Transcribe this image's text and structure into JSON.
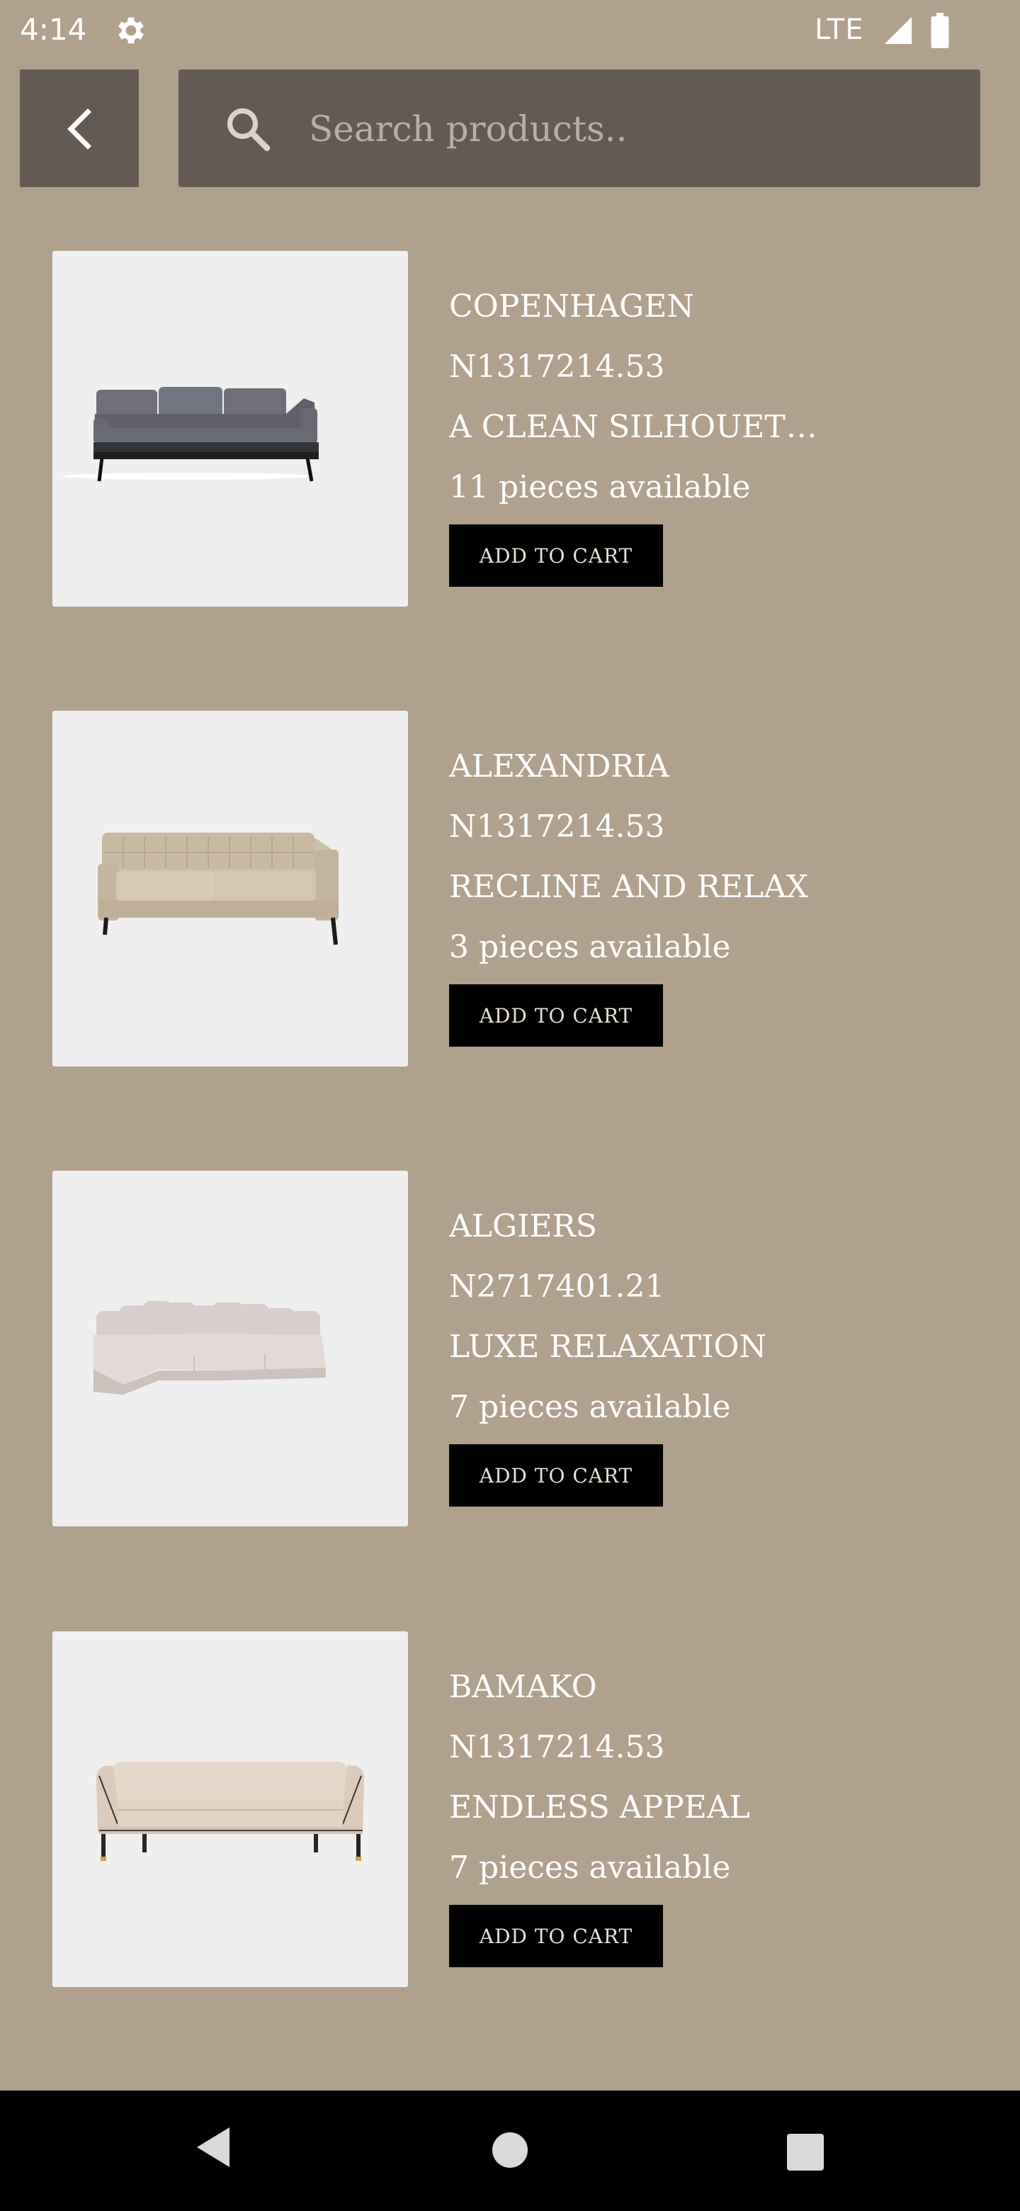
{
  "status_bar": {
    "time": "4:14",
    "network": "LTE",
    "icons": [
      "gear-icon",
      "signal-icon",
      "battery-icon"
    ]
  },
  "header": {
    "back_icon": "chevron-left-icon",
    "search_icon": "search-icon",
    "search_placeholder": "Search products..",
    "search_value": ""
  },
  "products": [
    {
      "name": "COPENHAGEN",
      "price": "N1317214.53",
      "tagline": "A CLEAN SILHOUETT...",
      "availability": "11 pieces available",
      "button_label": "ADD TO CART",
      "image": "grey-sofa"
    },
    {
      "name": "ALEXANDRIA",
      "price": "N1317214.53",
      "tagline": "RECLINE AND RELAX",
      "availability": "3 pieces available",
      "button_label": "ADD TO CART",
      "image": "beige-tufted-sofa"
    },
    {
      "name": "ALGIERS",
      "price": "N2717401.21",
      "tagline": "LUXE RELAXATION",
      "availability": "7 pieces available",
      "button_label": "ADD TO CART",
      "image": "sectional-sofa"
    },
    {
      "name": "BAMAKO",
      "price": "N1317214.53",
      "tagline": "ENDLESS APPEAL",
      "availability": "7 pieces available",
      "button_label": "ADD TO CART",
      "image": "cream-sofa"
    }
  ],
  "nav_bar": {
    "icons": [
      "back-triangle-icon",
      "home-circle-icon",
      "recents-square-icon"
    ]
  },
  "colors": {
    "background": "#afa18e",
    "header_box": "#645a54",
    "button": "#000000",
    "text": "#ffffff"
  }
}
